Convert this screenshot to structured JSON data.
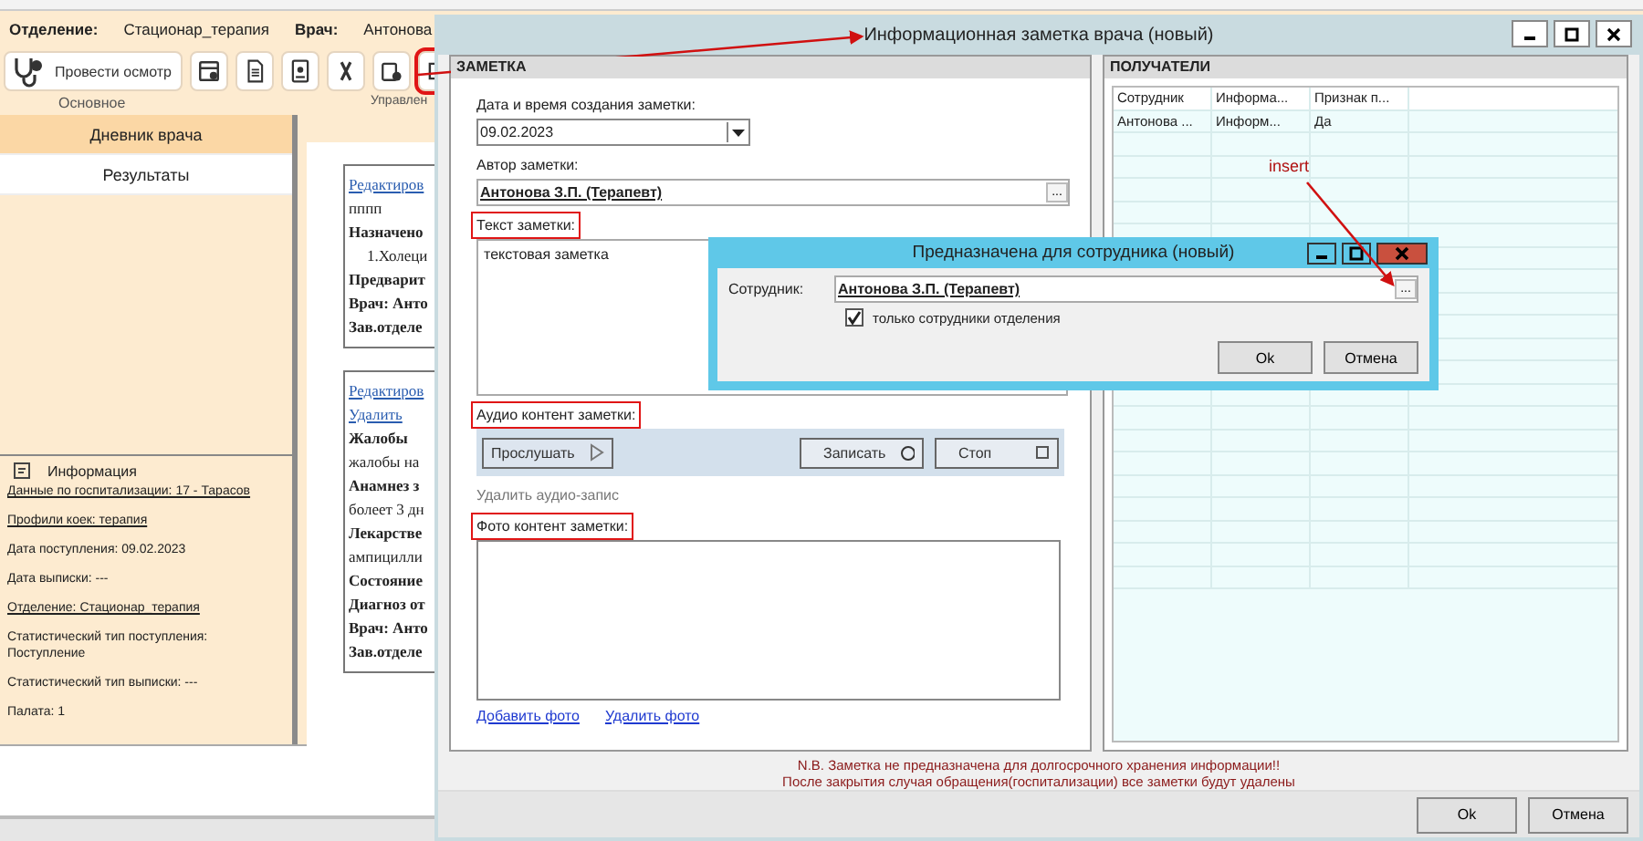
{
  "header": {
    "department_label": "Отделение:",
    "department": "Стационар_терапия",
    "doctor_label": "Врач:",
    "doctor": "Антонова"
  },
  "toolbar": {
    "exam_button": "Провести осмотр",
    "icons": [
      {
        "kind": "form",
        "highlighted": false
      },
      {
        "kind": "document",
        "highlighted": false
      },
      {
        "kind": "badge",
        "highlighted": false
      },
      {
        "kind": "ribbon",
        "highlighted": false
      },
      {
        "kind": "clipboard",
        "highlighted": false
      },
      {
        "kind": "note",
        "highlighted": true
      }
    ],
    "groups": [
      "Основное",
      "Управлен"
    ]
  },
  "sidebar": {
    "tabs": [
      {
        "label": "Дневник врача",
        "selected": true
      },
      {
        "label": "Результаты",
        "selected": false
      }
    ],
    "info": {
      "title": "Информация",
      "lines": [
        {
          "text": "Данные по госпитализации: 17 - Тарасов",
          "link": true
        },
        {
          "text": "Профили коек: терапия",
          "link": true
        },
        {
          "text": "Дата поступления: 09.02.2023",
          "link": false
        },
        {
          "text": "Дата выписки: ---",
          "link": false
        },
        {
          "text": "Отделение: Стационар_терапия",
          "link": true
        },
        {
          "text": "Статистический тип поступления: Поступление",
          "link": false
        },
        {
          "text": "Статистический тип выписки: ---",
          "link": false
        },
        {
          "text": "Палата: 1",
          "link": false
        }
      ]
    }
  },
  "document": {
    "entries": [
      [
        {
          "text": "Редактиров",
          "kind": "link"
        },
        {
          "text": "пппп",
          "kind": "plain"
        },
        {
          "text": "Назначено",
          "kind": "bold"
        },
        {
          "text": "1.Холеци",
          "kind": "item"
        },
        {
          "text": "Предварит",
          "kind": "bold"
        },
        {
          "text": "Врач: Анто",
          "kind": "bold"
        },
        {
          "text": "Зав.отделе",
          "kind": "bold"
        }
      ],
      [
        {
          "text": "Редактиров",
          "kind": "link"
        },
        {
          "text": "Удалить",
          "kind": "link"
        },
        {
          "text": "Жалобы",
          "kind": "bold"
        },
        {
          "text": "жалобы на",
          "kind": "plain"
        },
        {
          "text": "Анамнез з",
          "kind": "bold"
        },
        {
          "text": "болеет 3 дн",
          "kind": "plain"
        },
        {
          "text": "Лекарстве",
          "kind": "bold"
        },
        {
          "text": "ампицилли",
          "kind": "plain"
        },
        {
          "text": "Состояние",
          "kind": "bold"
        },
        {
          "text": "Диагноз от",
          "kind": "bold"
        },
        {
          "text": "Врач: Анто",
          "kind": "bold"
        },
        {
          "text": "Зав.отделе",
          "kind": "bold"
        }
      ]
    ]
  },
  "dialog": {
    "title": "Информационная заметка врача (новый)",
    "note_panel": {
      "title": "ЗАМЕТКА",
      "date_label": "Дата и время создания заметки:",
      "date": "09.02.2023",
      "author_label": "Автор заметки:",
      "author": "Антонова  З.П. (Терапевт)",
      "author_button": "...",
      "text_label": {
        "text": "Текст заметки:",
        "highlighted": true
      },
      "text": "текстовая заметка",
      "audio_label": {
        "text": "Аудио контент заметки:",
        "highlighted": true
      },
      "play": "Прослушать",
      "record": "Записать",
      "stop": "Стоп",
      "delete_audio": "Удалить аудио-запис",
      "photo_label": {
        "text": "Фото контент заметки:",
        "highlighted": true
      },
      "add_photo": "Добавить фото",
      "delete_photo": "Удалить фото"
    },
    "recipients": {
      "title": "ПОЛУЧАТЕЛИ",
      "columns": [
        "Сотрудник",
        "Информа...",
        "Признак п..."
      ],
      "rows": [
        [
          "Антонова ...",
          "Информ...",
          "Да"
        ]
      ]
    },
    "warning": [
      "N.B. Заметка не предназначена для долгосрочного хранения информации!!",
      "После закрытия случая обращения(госпитализации) все заметки будут удалены"
    ],
    "buttons": [
      "Ok",
      "Отмена"
    ]
  },
  "subdialog": {
    "title": "Предназначена для сотрудника (новый)",
    "employee_label": "Сотрудник:",
    "employee": "Антонова  З.П. (Терапевт)",
    "browse": "...",
    "only_department": {
      "label": "только сотрудники отделения",
      "checked": true
    },
    "buttons": [
      "Ok",
      "Отмена"
    ]
  },
  "annotation": {
    "text": "insert"
  }
}
